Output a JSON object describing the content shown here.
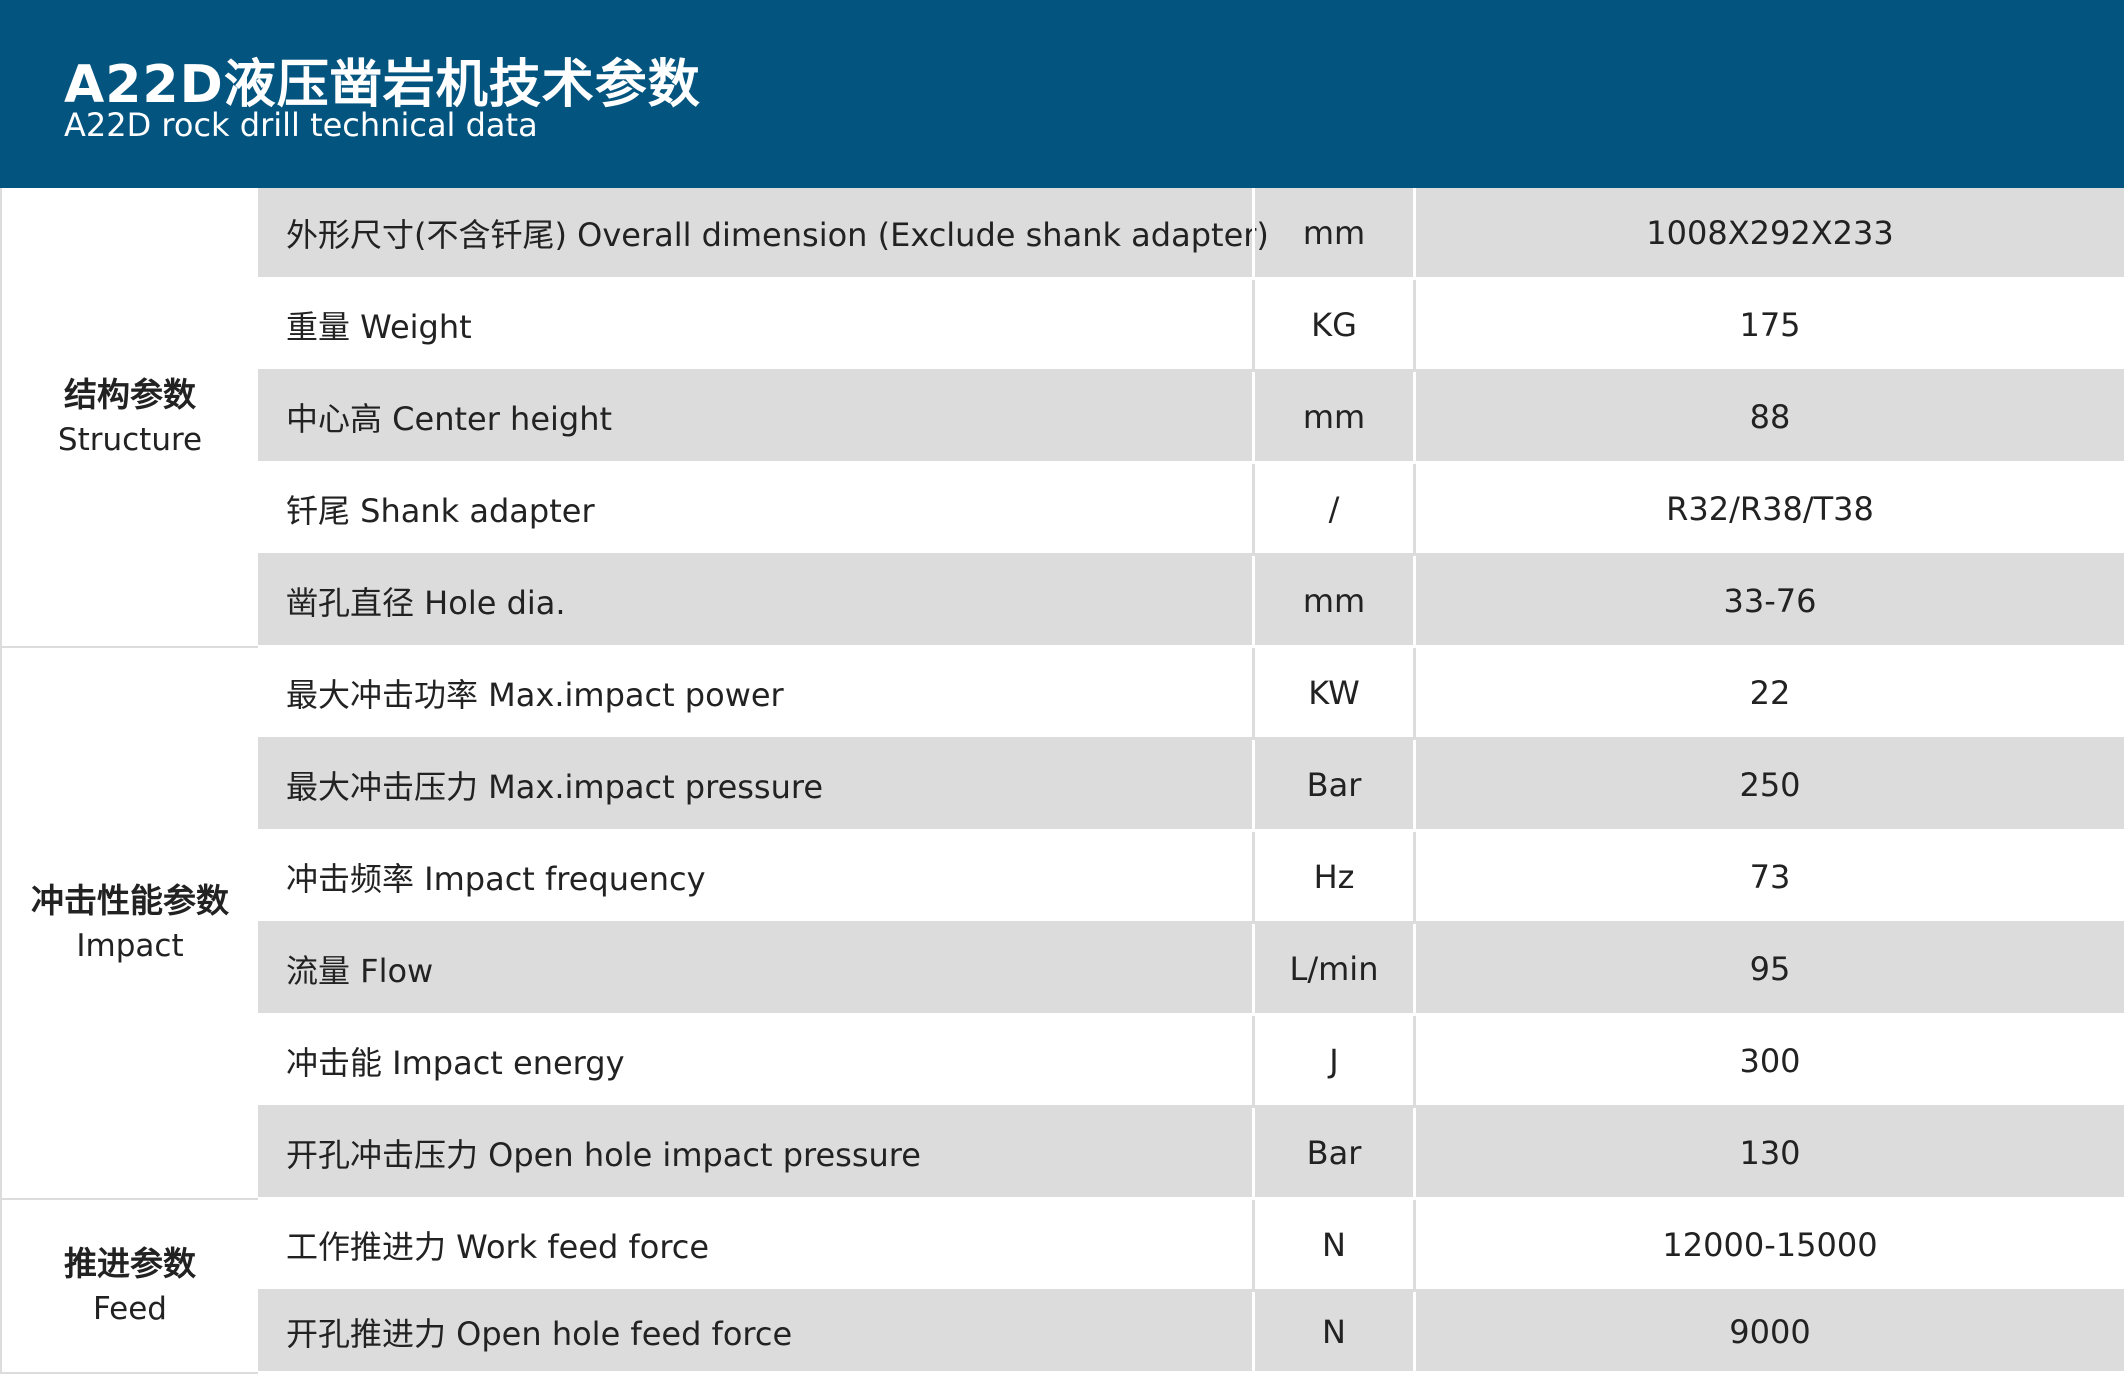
{
  "header": {
    "title": "A22D液压凿岩机技术参数",
    "subtitle": "A22D rock drill technical data",
    "bg_color": "#035580"
  },
  "groups": [
    {
      "cn": "结构参数",
      "en": "Structure",
      "rows": [
        {
          "param": "外形尺寸(不含钎尾) Overall dimension (Exclude shank adapter)",
          "unit": "mm",
          "value": "1008X292X233"
        },
        {
          "param": "重量 Weight",
          "unit": "KG",
          "value": "175"
        },
        {
          "param": "中心高 Center height",
          "unit": "mm",
          "value": "88"
        },
        {
          "param": "钎尾 Shank adapter",
          "unit": "/",
          "value": "R32/R38/T38"
        },
        {
          "param": "凿孔直径 Hole dia.",
          "unit": "mm",
          "value": "33-76"
        }
      ]
    },
    {
      "cn": "冲击性能参数",
      "en": "Impact",
      "rows": [
        {
          "param": "最大冲击功率 Max.impact power",
          "unit": "KW",
          "value": "22"
        },
        {
          "param": "最大冲击压力 Max.impact pressure",
          "unit": "Bar",
          "value": "250"
        },
        {
          "param": "冲击频率 Impact frequency",
          "unit": "Hz",
          "value": "73"
        },
        {
          "param": "流量 Flow",
          "unit": "L/min",
          "value": "95"
        },
        {
          "param": "冲击能 Impact energy",
          "unit": "J",
          "value": "300"
        },
        {
          "param": "开孔冲击压力 Open hole impact pressure",
          "unit": "Bar",
          "value": "130"
        }
      ]
    },
    {
      "cn": "推进参数",
      "en": "Feed",
      "rows": [
        {
          "param": "工作推进力 Work feed force",
          "unit": "N",
          "value": "12000-15000"
        },
        {
          "param": "开孔推进力 Open hole feed force",
          "unit": "N",
          "value": "9000"
        }
      ]
    }
  ]
}
